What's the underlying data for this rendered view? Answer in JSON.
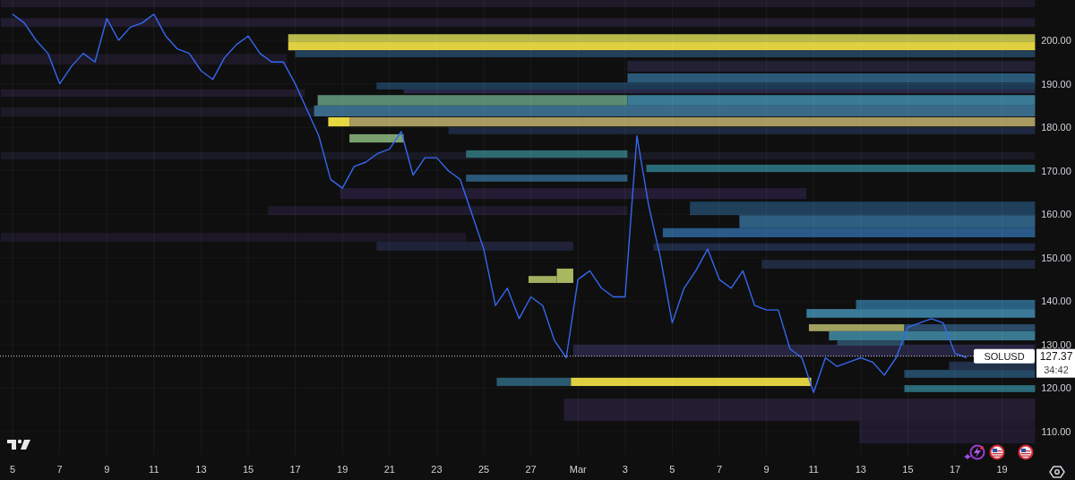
{
  "chart": {
    "price": "127.37",
    "countdown": "34:42",
    "chart_data": {
      "type": "line",
      "grid": true,
      "ylim": [
        104.65,
        209.27
      ],
      "categories": [
        "5",
        null,
        null,
        null,
        "7",
        null,
        null,
        null,
        "9",
        null,
        null,
        null,
        "11",
        null,
        null,
        null,
        "13",
        null,
        null,
        null,
        "15",
        null,
        null,
        null,
        "17",
        null,
        null,
        null,
        "19",
        null,
        null,
        null,
        "21",
        null,
        null,
        null,
        "23",
        null,
        null,
        null,
        "25",
        null,
        null,
        null,
        "27",
        null,
        null,
        null,
        "Mar",
        null,
        null,
        null,
        "3",
        null,
        null,
        null,
        "5",
        null,
        null,
        null,
        "7",
        null,
        null,
        null,
        "9",
        null,
        null,
        null,
        "11",
        null,
        null,
        null,
        "13",
        null,
        null,
        null,
        "15",
        null,
        null,
        null,
        "17",
        null,
        null,
        null,
        "19"
      ],
      "series": [
        {
          "name": "SOLUSD",
          "color": "#3568f0",
          "values": [
            206,
            204,
            200,
            197,
            190,
            194,
            197,
            195,
            205,
            200,
            203,
            204,
            206,
            201,
            198,
            197,
            193,
            191,
            196,
            199,
            201,
            197,
            195,
            195,
            190,
            184,
            178,
            168,
            166,
            171,
            172,
            174,
            175,
            179,
            169,
            173,
            173,
            170,
            168,
            160,
            152,
            139,
            143,
            136,
            141,
            139,
            131,
            127,
            145,
            147,
            143,
            141,
            141,
            178,
            162,
            150,
            135,
            143,
            147,
            152,
            145,
            143,
            147,
            139,
            138,
            138,
            129,
            127,
            119,
            127,
            125,
            126,
            127,
            126,
            123,
            127,
            134,
            135,
            136,
            135,
            128,
            127,
            null,
            null,
            null
          ]
        }
      ],
      "ref_lines": [
        {
          "axis": "y",
          "value": 127.37
        }
      ],
      "yticks": [
        {
          "value": 110,
          "label": "110.00"
        },
        {
          "value": 120,
          "label": "120.00"
        },
        {
          "value": 130,
          "label": "130.00"
        },
        {
          "value": 140,
          "label": "140.00"
        },
        {
          "value": 150,
          "label": "150.00"
        },
        {
          "value": 160,
          "label": "160.00"
        },
        {
          "value": 170,
          "label": "170.00"
        },
        {
          "value": 180,
          "label": "180.00"
        },
        {
          "value": 190,
          "label": "190.00"
        },
        {
          "value": 200,
          "label": "200.00"
        }
      ]
    }
  }
}
